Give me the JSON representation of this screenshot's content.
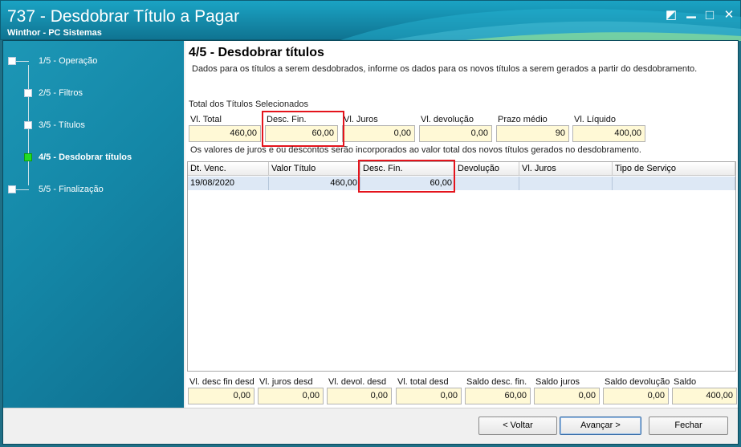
{
  "window": {
    "title": "737 - Desdobrar Título a Pagar",
    "subtitle": "Winthor - PC Sistemas",
    "restore_glyph": "◩",
    "minimize_glyph": "▁",
    "maximize_glyph": "□",
    "close_glyph": "✕"
  },
  "steps": [
    {
      "label": "1/5 - Operação",
      "active": false
    },
    {
      "label": "2/5 - Filtros",
      "active": false
    },
    {
      "label": "3/5 - Títulos",
      "active": false
    },
    {
      "label": "4/5 - Desdobrar títulos",
      "active": true
    },
    {
      "label": "5/5 - Finalização",
      "active": false
    }
  ],
  "main": {
    "heading": "4/5 - Desdobrar títulos",
    "description": "Dados para os títulos a serem desdobrados, informe os dados para os novos títulos a serem gerados a partir do desdobramento.",
    "section_label": "Total dos Títulos Selecionados",
    "totals": [
      {
        "label": "Vl. Total",
        "value": "460,00"
      },
      {
        "label": "Desc. Fin.",
        "value": "60,00"
      },
      {
        "label": "Vl. Juros",
        "value": "0,00"
      },
      {
        "label": "Vl. devolução",
        "value": "0,00"
      },
      {
        "label": "Prazo médio",
        "value": "90"
      },
      {
        "label": "Vl. Líquido",
        "value": "400,00"
      }
    ],
    "note": "Os valores de juros e ou descontos serão incorporados ao valor total dos novos títulos gerados no desdobramento.",
    "grid": {
      "columns": [
        "Dt. Venc.",
        "Valor Título",
        "Desc. Fin.",
        "Devolução",
        "Vl. Juros",
        "Tipo de Serviço"
      ],
      "rows": [
        [
          "19/08/2020",
          "460,00",
          "60,00",
          "",
          "",
          ""
        ]
      ]
    },
    "summary": [
      {
        "label": "Vl. desc fin desd",
        "value": "0,00"
      },
      {
        "label": "Vl. juros desd",
        "value": "0,00"
      },
      {
        "label": "Vl. devol. desd",
        "value": "0,00"
      },
      {
        "label": "Vl. total desd",
        "value": "0,00"
      },
      {
        "label": "Saldo desc. fin.",
        "value": "60,00"
      },
      {
        "label": "Saldo juros",
        "value": "0,00"
      },
      {
        "label": "Saldo devolução",
        "value": "0,00"
      },
      {
        "label": "Saldo",
        "value": "400,00"
      }
    ]
  },
  "buttons": {
    "back": "< Voltar",
    "next": "Avançar >",
    "close": "Fechar"
  },
  "colors": {
    "highlight": "#e4141c",
    "field_bg": "#fff9d6",
    "active_step": "#22dd22"
  }
}
